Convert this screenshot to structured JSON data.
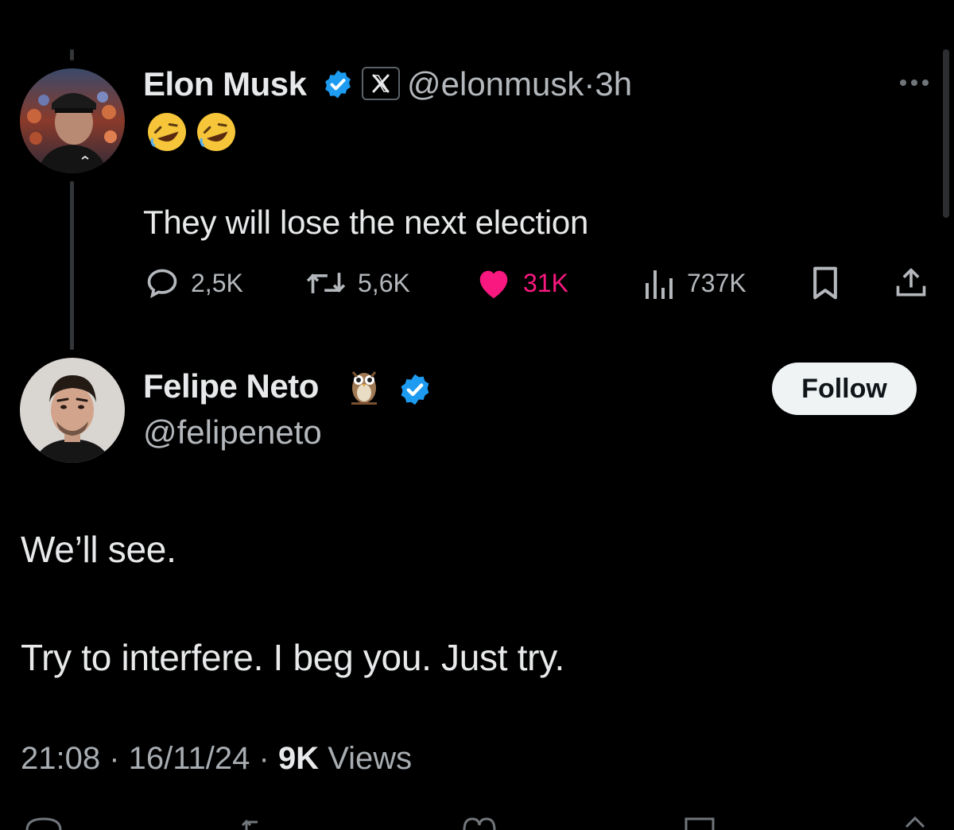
{
  "parent_tweet": {
    "author_name": "Elon Musk",
    "handle": "@elonmusk",
    "separator": "·",
    "time_ago": "3h",
    "emoji_line": "🤣🤣",
    "text": "They will lose the next election",
    "stats": {
      "replies": "2,5K",
      "reposts": "5,6K",
      "likes": "31K",
      "views": "737K"
    },
    "colors": {
      "like": "#f91880",
      "verified": "#1d9bf0"
    }
  },
  "reply_tweet": {
    "author_name": "Felipe Neto",
    "owl_emoji": "🦉",
    "handle": "@felipeneto",
    "follow_label": "Follow",
    "paragraph_1": "We’ll see.",
    "paragraph_2": "Try to interfere. I beg you. Just try.",
    "time": "21:08",
    "sep1": " · ",
    "date": "16/11/24",
    "sep2": " · ",
    "views_count": "9K",
    "views_label": " Views"
  }
}
